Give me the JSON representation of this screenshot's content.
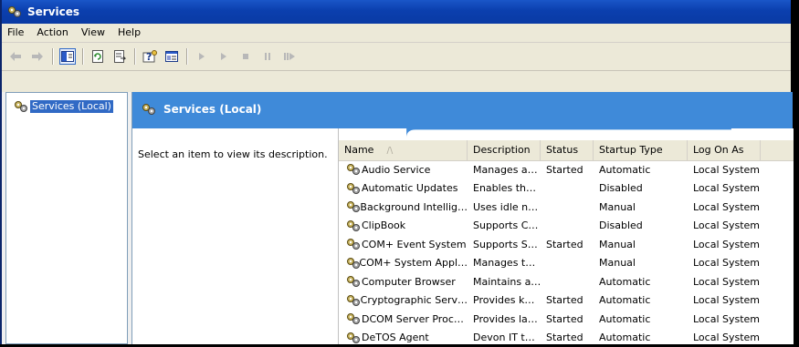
{
  "window": {
    "title": "Services"
  },
  "menu": {
    "items": [
      "File",
      "Action",
      "View",
      "Help"
    ]
  },
  "toolbar": {
    "buttons": [
      "back-icon",
      "forward-icon",
      "show-hide-tree-icon",
      "refresh-icon",
      "export-list-icon",
      "help-icon",
      "properties-icon",
      "start-service-icon",
      "resume-service-icon",
      "stop-service-icon",
      "pause-service-icon",
      "restart-service-icon"
    ]
  },
  "tree": {
    "root_label": "Services (Local)"
  },
  "header": {
    "title": "Services (Local)"
  },
  "description_pane": {
    "text": "Select an item to view its description."
  },
  "table": {
    "columns": [
      "Name",
      "Description",
      "Status",
      "Startup Type",
      "Log On As"
    ],
    "sort_indicator": "/\\",
    "rows": [
      {
        "name": "Audio Service",
        "description": "Manages a…",
        "status": "Started",
        "startup": "Automatic",
        "logon": "Local System"
      },
      {
        "name": "Automatic Updates",
        "description": "Enables th…",
        "status": "",
        "startup": "Disabled",
        "logon": "Local System"
      },
      {
        "name": "Background Intellig…",
        "description": "Uses idle n…",
        "status": "",
        "startup": "Manual",
        "logon": "Local System"
      },
      {
        "name": "ClipBook",
        "description": "Supports C…",
        "status": "",
        "startup": "Disabled",
        "logon": "Local System"
      },
      {
        "name": "COM+ Event System",
        "description": "Supports S…",
        "status": "Started",
        "startup": "Manual",
        "logon": "Local System"
      },
      {
        "name": "COM+ System Appl…",
        "description": "Manages t…",
        "status": "",
        "startup": "Manual",
        "logon": "Local System"
      },
      {
        "name": "Computer Browser",
        "description": "Maintains a…",
        "status": "",
        "startup": "Automatic",
        "logon": "Local System"
      },
      {
        "name": "Cryptographic Serv…",
        "description": "Provides k…",
        "status": "Started",
        "startup": "Automatic",
        "logon": "Local System"
      },
      {
        "name": "DCOM Server Proc…",
        "description": "Provides la…",
        "status": "Started",
        "startup": "Automatic",
        "logon": "Local System"
      },
      {
        "name": "DeTOS Agent",
        "description": "Devon IT t…",
        "status": "Started",
        "startup": "Automatic",
        "logon": "Local System"
      }
    ]
  },
  "colors": {
    "titlebar": "#0b3fae",
    "header": "#3f8ad9",
    "selection": "#316ac5"
  }
}
